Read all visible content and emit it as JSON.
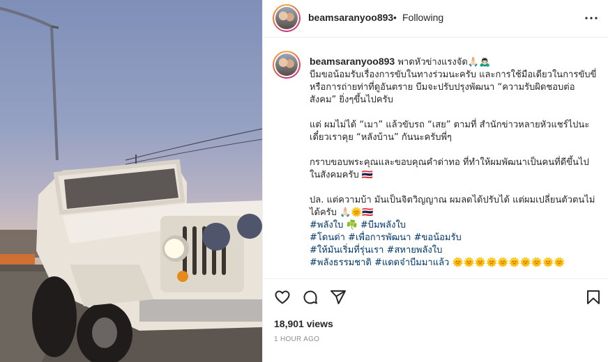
{
  "post": {
    "username": "beamsaranyoo893",
    "separator": "•",
    "follow_status": "Following",
    "more_icon": "more-horizontal-icon"
  },
  "caption": {
    "username": "beamsaranyoo893",
    "first_line": " พาดหัวข่างแรงจัด🙏🏻🙇🏻‍♂️",
    "p1": "บีมขอน้อมรับเรื่องการขับในทางร่วมนะครับ และการใช้มือเดียวในการขับขี่หรือการถ่ายท่าที่ดูอันตราย บีมจะปรับปรุงพัฒนา “ความรับผิดชอบต่อสังคม” ยิ่งๆขึ้นไปครับ",
    "p2": "แต่ ผมไม่ได้ “เมา” แล้วขับรถ “เสย” ตามที่ สำนักข่าวหลายหัวแชร์ไปนะเดี๋ยวเราคุย “หลังบ้าน” กันนะครับพี่ๆ",
    "p3": "กราบขอบพระคุณและขอบคุณคำด่าทอ ที่ทำให้ผมพัฒนาเป็นคนที่ดีขึ้นไปในสังคมครับ 🇹🇭",
    "p4": "ปล. แต่ความบ้า มันเป็นจิตวิญญาณ ผมลดได้ปรับได้ แต่ผมเปลี่ยนตัวตนไม่ได้ครับ 🙏🏻🌞🇹🇭",
    "tags_line1_a": "#พลังใบ",
    "tags_line1_emoji": " ☘️ ",
    "tags_line1_b": "#บีมพลังใบ",
    "tags_line2_a": "#โดนด่า",
    "tags_line2_b": "#เพื่อการพัฒนา",
    "tags_line2_c": "#ขอน้อมรับ",
    "tags_line3_a": "#ให้มันเริ่มที่รุ่นเรา",
    "tags_line3_b": "#สหายพลังใบ",
    "tags_line4_a": "#พลังธรรมชาติ",
    "tags_line4_b": "#แดดจ๋าบีมมาแล้ว",
    "tags_line4_emoji": " 🌞🌞🌞🌞🌞🌞🌞🌞🌞🌞"
  },
  "actions": {
    "like_icon": "heart-icon",
    "comment_icon": "comment-icon",
    "share_icon": "send-icon",
    "save_icon": "bookmark-icon",
    "views": "18,901 views",
    "time": "1 HOUR AGO"
  },
  "colors": {
    "hashtag": "#00376b",
    "text": "#262626",
    "secondary": "#8e8e8e",
    "divider": "#efefef"
  }
}
